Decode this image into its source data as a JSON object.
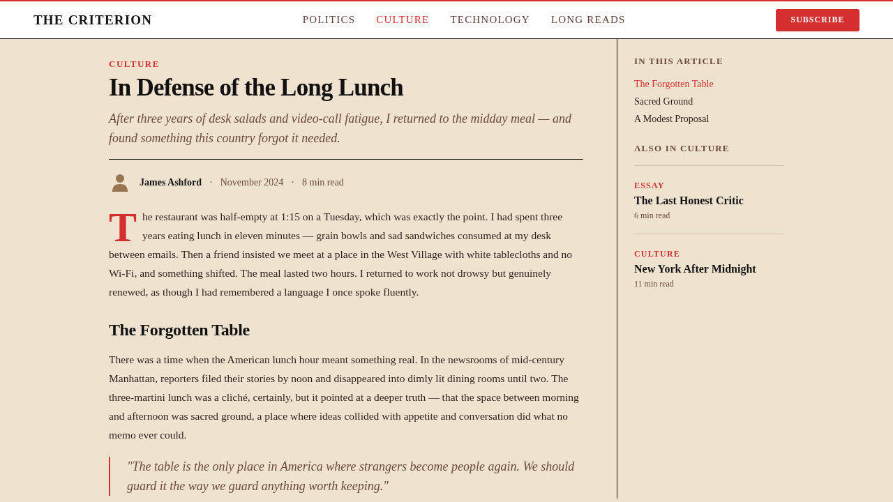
{
  "header": {
    "logo": "THE CRITERION",
    "nav": [
      {
        "label": "POLITICS",
        "selected": false
      },
      {
        "label": "CULTURE",
        "selected": true
      },
      {
        "label": "TECHNOLOGY",
        "selected": false
      },
      {
        "label": "LONG READS",
        "selected": false
      }
    ],
    "subscribe": "SUBSCRIBE"
  },
  "article": {
    "category": "CULTURE",
    "title": "In Defense of the Long Lunch",
    "dek": "After three years of desk salads and video-call fatigue, I returned to the midday meal — and found something this country forgot it needed.",
    "byline": {
      "author": "James Ashford",
      "date": "November 2024",
      "read_time": "8 min read",
      "separators": [
        "·",
        "·"
      ]
    },
    "body": [
      {
        "kind": "paragraph",
        "drop_cap": true,
        "text": "The restaurant was half-empty at 1:15 on a Tuesday, which was exactly the point. I had spent three years eating lunch in eleven minutes — grain bowls and sad sandwiches consumed at my desk between emails. Then a friend insisted we meet at a place in the West Village with white tablecloths and no Wi-Fi, and something shifted. The meal lasted two hours. I returned to work not drowsy but genuinely renewed, as though I had remembered a language I once spoke fluently."
      },
      {
        "kind": "heading",
        "text": "The Forgotten Table"
      },
      {
        "kind": "paragraph",
        "drop_cap": false,
        "text": "There was a time when the American lunch hour meant something real. In the newsrooms of mid-century Manhattan, reporters filed their stories by noon and disappeared into dimly lit dining rooms until two. The three-martini lunch was a cliché, certainly, but it pointed at a deeper truth — that the space between morning and afternoon was sacred ground, a place where ideas collided with appetite and conversation did what no memo ever could."
      },
      {
        "kind": "quote",
        "text": "\"The table is the only place in America where strangers become people again. We should guard it the way we guard anything worth keeping.\""
      }
    ]
  },
  "sidebar": {
    "toc": {
      "title": "IN THIS ARTICLE",
      "items": [
        {
          "label": "The Forgotten Table",
          "selected": true
        },
        {
          "label": "Sacred Ground",
          "selected": false
        },
        {
          "label": "A Modest Proposal",
          "selected": false
        }
      ]
    },
    "related": {
      "title": "ALSO IN CULTURE",
      "items": [
        {
          "category": "ESSAY",
          "title": "The Last Honest Critic",
          "read_time": "6 min read"
        },
        {
          "category": "CULTURE",
          "title": "New York After Midnight",
          "read_time": "11 min read"
        }
      ]
    }
  }
}
